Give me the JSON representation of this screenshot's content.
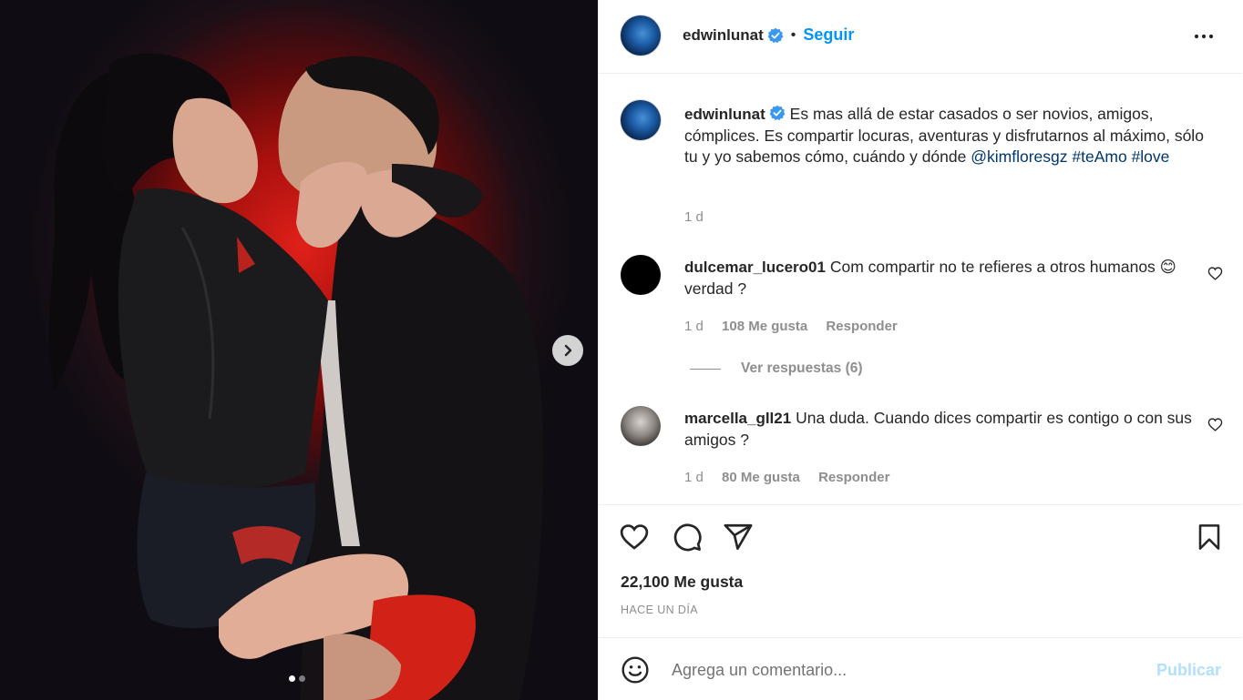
{
  "post": {
    "author": "edwinlunat",
    "follow_label": "Seguir",
    "separator": "•",
    "caption": {
      "text": "Es mas allá de estar casados o ser novios, amigos, cómplices. Es compartir locuras, aventuras y disfrutarnos al máximo, sólo tu y yo sabemos cómo, cuándo y dónde",
      "mention": "@kimfloresgz",
      "tag1": "#teAmo",
      "tag2": "#love",
      "age": "1 d"
    },
    "media": {
      "slide_count": 2,
      "current_slide": 1
    }
  },
  "comments": [
    {
      "user": "dulcemar_lucero01",
      "text": "Com compartir no te refieres a otros humanos 😊 verdad ?",
      "age": "1 d",
      "likes": "108 Me gusta",
      "reply": "Responder",
      "view_replies": "Ver respuestas (6)"
    },
    {
      "user": "marcella_gll21",
      "text": "Una duda. Cuando dices compartir es contigo o con sus amigos ?",
      "age": "1 d",
      "likes": "80 Me gusta",
      "reply": "Responder"
    }
  ],
  "stats": {
    "likes": "22,100 Me gusta",
    "time_ago": "HACE UN DÍA"
  },
  "add_comment": {
    "placeholder": "Agrega un comentario...",
    "publish": "Publicar"
  },
  "colors": {
    "accent": "#0095f6",
    "link": "#00376b",
    "muted": "#8e8e8e",
    "publish_disabled": "#b2dffc"
  }
}
